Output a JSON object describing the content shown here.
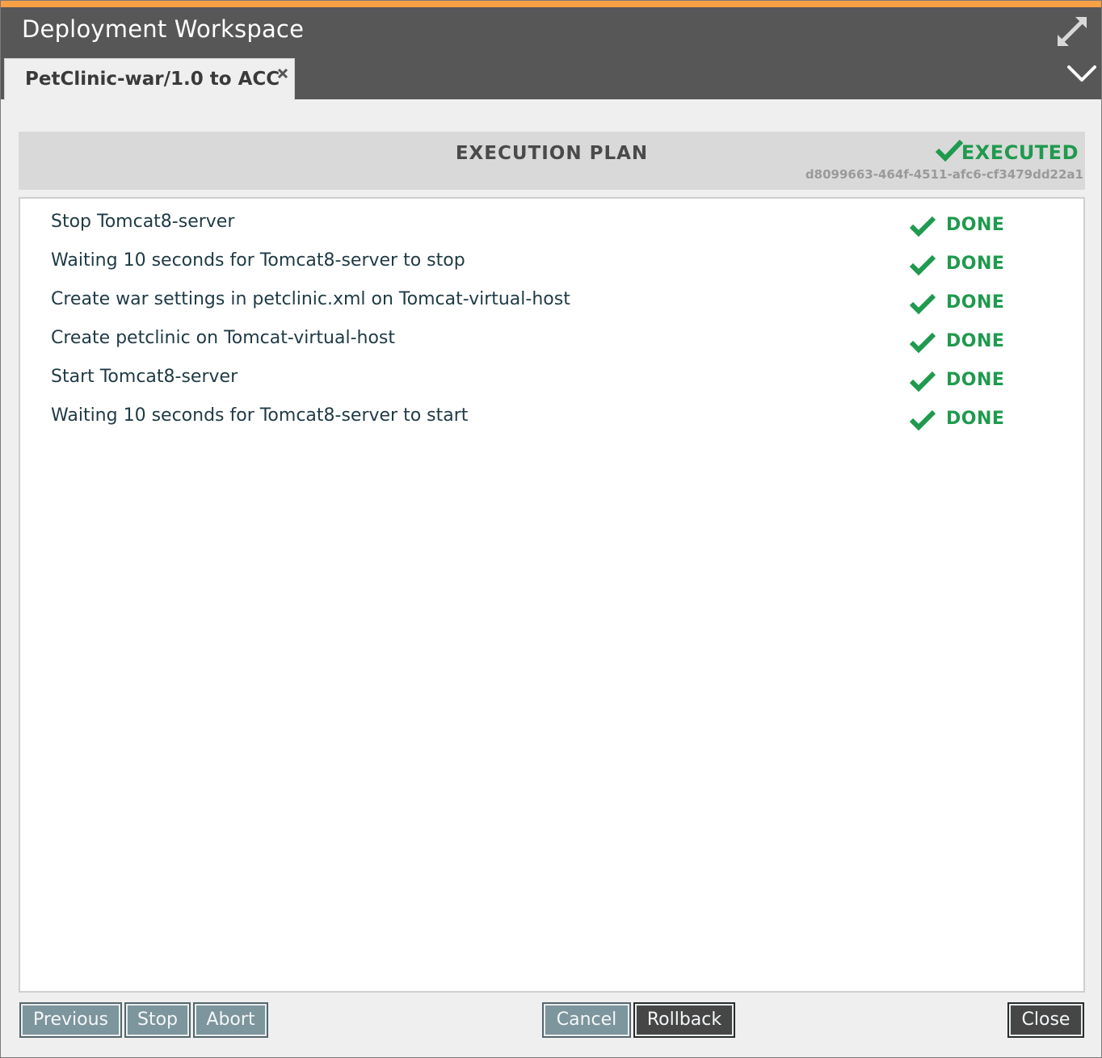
{
  "window": {
    "title": "Deployment Workspace",
    "accent_color": "#f7a046",
    "titlebar_color": "#575757",
    "icons": [
      "expand-icon",
      "chevron-down-icon"
    ]
  },
  "tab": {
    "label": "PetClinic-war/1.0 to ACC",
    "close_icon": "close-icon"
  },
  "plan": {
    "title": "EXECUTION PLAN",
    "status": "EXECUTED",
    "status_color": "#1f9a4e",
    "task_id": "d8099663-464f-4511-afc6-cf3479dd22a1",
    "steps": [
      {
        "description": "Stop Tomcat8-server",
        "state": "DONE"
      },
      {
        "description": "Waiting 10 seconds for Tomcat8-server to stop",
        "state": "DONE"
      },
      {
        "description": "Create war settings in petclinic.xml on Tomcat-virtual-host",
        "state": "DONE"
      },
      {
        "description": "Create petclinic on Tomcat-virtual-host",
        "state": "DONE"
      },
      {
        "description": "Start Tomcat8-server",
        "state": "DONE"
      },
      {
        "description": "Waiting 10 seconds for Tomcat8-server to start",
        "state": "DONE"
      }
    ]
  },
  "buttons": {
    "previous": "Previous",
    "stop": "Stop",
    "abort": "Abort",
    "cancel": "Cancel",
    "rollback": "Rollback",
    "close": "Close"
  }
}
